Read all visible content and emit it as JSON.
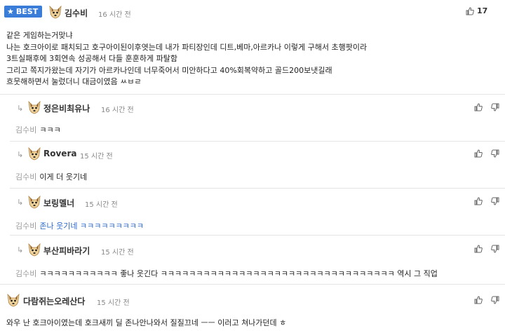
{
  "best_comment": {
    "badge": "BEST",
    "nickname": "김수비",
    "time": "16 시간 전",
    "likes": "17",
    "lines": [
      "같은 게임하는거맞냐",
      "나는 호크아이로 패치되고 호구아이된이후엿는데 내가 파티장인데 디트,베마,아르카나 이렇게 구해서 초행팟이라",
      "3트실패후에 3회연속 성공해서 다들 훈훈하게 파탈함",
      "그리고 쪽지가왔는데 자기가 아르카나인데 너무죽어서 미안하다고 40%회복약하고 골드200보냇길래",
      "흐뭇해하면서 눌렀더니 대금이였음 ㅆㅂㄹ"
    ]
  },
  "replies": [
    {
      "nickname": "정은비최유나",
      "time": "16 시간 전",
      "reply_to": "김수비",
      "text": "ㅋㅋㅋ",
      "blue": false
    },
    {
      "nickname": "Rovera",
      "time": "15 시간 전",
      "reply_to": "김수비",
      "text": "이게 더 웃기네",
      "blue": false
    },
    {
      "nickname": "보링멜너",
      "time": "15 시간 전",
      "reply_to": "김수비",
      "text": "존나 웃기네 ㅋㅋㅋㅋㅋㅋㅋㅋㅋ",
      "blue": true
    },
    {
      "nickname": "부산피바라기",
      "time": "15 시간 전",
      "reply_to": "김수비",
      "text": "ㅋㅋㅋㅋㅋㅋㅋㅋㅋㅋㅋ 좋나 웃긴다 ㅋㅋㅋㅋㅋㅋㅋㅋㅋㅋㅋㅋㅋㅋㅋㅋㅋㅋㅋㅋㅋㅋㅋㅋㅋㅋㅋㅋㅋㅋㅋㅋㅋ 역시 그 직업",
      "blue": false
    }
  ],
  "next_comment": {
    "nickname": "다람쥐는오레산다",
    "time": "15 시간 전",
    "text": "와우 난 호크아이였는데 호크새끼 딜 존나안나와서 질질끄네 ㅡㅡ 이러고 쳐나가던데 ㅎ"
  }
}
